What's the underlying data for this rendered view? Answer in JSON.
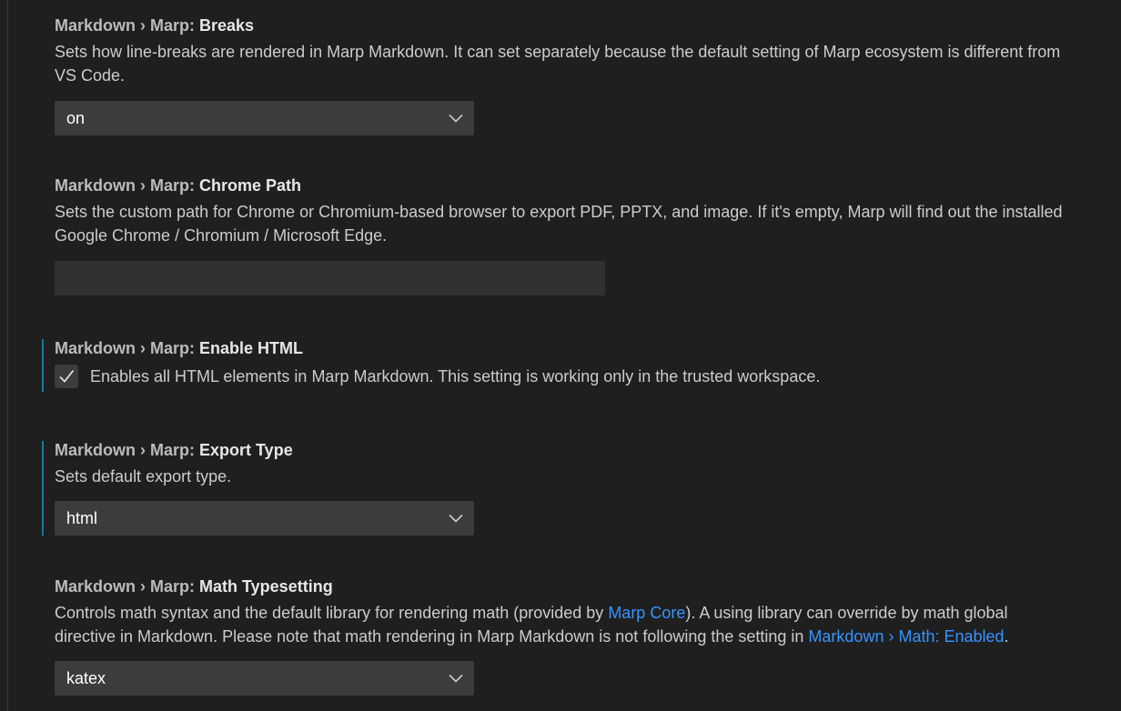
{
  "settings": {
    "breaks": {
      "category": "Markdown › Marp: ",
      "name": "Breaks",
      "description": "Sets how line-breaks are rendered in Marp Markdown. It can set separately because the default setting of Marp ecosystem is different from VS Code.",
      "value": "on"
    },
    "chrome_path": {
      "category": "Markdown › Marp: ",
      "name": "Chrome Path",
      "description": "Sets the custom path for Chrome or Chromium-based browser to export PDF, PPTX, and image. If it's empty, Marp will find out the installed Google Chrome / Chromium / Microsoft Edge.",
      "value": ""
    },
    "enable_html": {
      "category": "Markdown › Marp: ",
      "name": "Enable HTML",
      "description": "Enables all HTML elements in Marp Markdown. This setting is working only in the trusted workspace.",
      "checked": true
    },
    "export_type": {
      "category": "Markdown › Marp: ",
      "name": "Export Type",
      "description": "Sets default export type.",
      "value": "html"
    },
    "math_typesetting": {
      "category": "Markdown › Marp: ",
      "name": "Math Typesetting",
      "desc_part1": "Controls math syntax and the default library for rendering math (provided by ",
      "desc_link1": "Marp Core",
      "desc_part2": "). A using library can override by math global directive in Markdown. Please note that math rendering in Marp Markdown is not following the setting in ",
      "desc_link2": "Markdown › Math: Enabled",
      "desc_part3": ".",
      "value": "katex"
    }
  },
  "colors": {
    "background": "#1f1f1f",
    "modified_indicator": "#0c7d9d",
    "link": "#3794ff",
    "dropdown_bg": "#3c3c3c"
  }
}
